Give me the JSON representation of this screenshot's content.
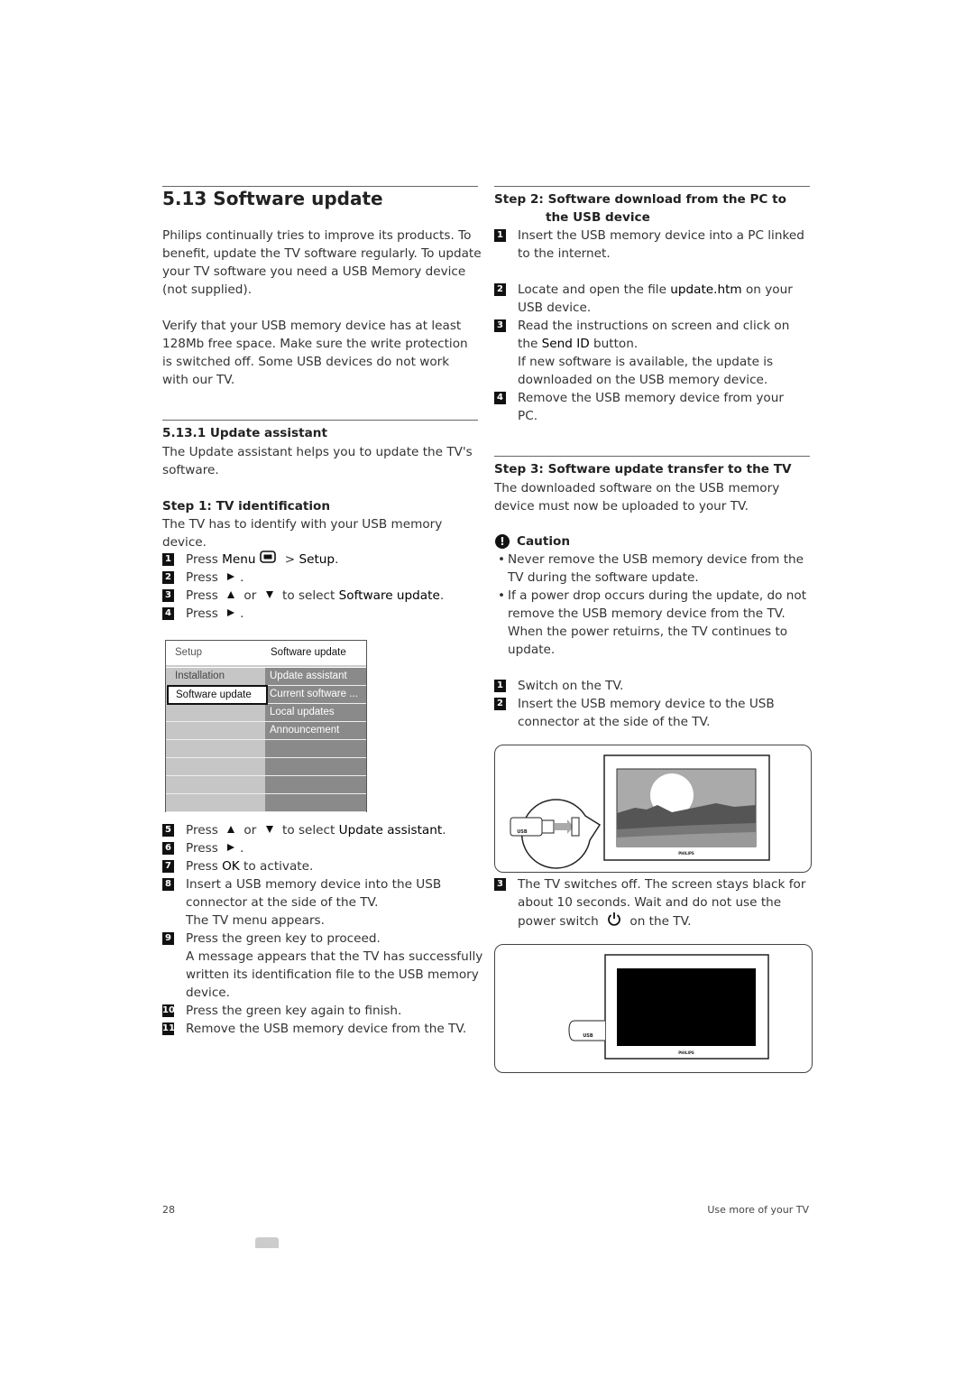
{
  "left": {
    "title": "5.13  Software update",
    "intro": [
      [
        "Philips continually tries to improve its products. To"
      ],
      [
        "benefit, update the TV software regularly. To update"
      ],
      [
        "your TV software you need a USB Memory device"
      ],
      [
        "(not supplied)."
      ]
    ],
    "verify": [
      [
        "Verify that your USB memory device has at least"
      ],
      [
        "128Mb free space. Make sure the write protection"
      ],
      [
        "is switched off. Some USB devices do not work"
      ],
      [
        "with our TV."
      ]
    ],
    "sub_heading": "5.13.1   Update assistant",
    "sub_text": [
      [
        "The Update assistant helps you to update the TV's"
      ],
      [
        "software."
      ]
    ],
    "step1_heading": "Step 1: TV identification",
    "step1_intro": [
      [
        "The TV has to identify with your USB memory"
      ],
      [
        "device."
      ]
    ],
    "steps_a": [
      {
        "n": "1",
        "lines": [
          [
            "Press ",
            {
              "b": "Menu"
            },
            {
              "icon": "menu"
            },
            " > ",
            {
              "b": "Setup"
            },
            "."
          ]
        ]
      },
      {
        "n": "2",
        "lines": [
          [
            "Press ",
            {
              "icon": "right"
            },
            "."
          ]
        ]
      },
      {
        "n": "3",
        "lines": [
          [
            "Press ",
            {
              "icon": "up"
            },
            " or ",
            {
              "icon": "down"
            },
            " to select ",
            {
              "b": "Software update"
            },
            "."
          ]
        ]
      },
      {
        "n": "4",
        "lines": [
          [
            "Press ",
            {
              "icon": "right"
            },
            "."
          ]
        ]
      }
    ],
    "menu": {
      "header_left": "Setup",
      "header_right": "Software update",
      "left_items": [
        "Installation",
        "Software update"
      ],
      "selected": "Software update",
      "right_items": [
        "Update assistant",
        "Current software ...",
        "Local updates",
        "Announcement"
      ],
      "empty_rows": 8
    },
    "steps_b": [
      {
        "n": "5",
        "lines": [
          [
            "Press ",
            {
              "icon": "up"
            },
            " or ",
            {
              "icon": "down"
            },
            " to select ",
            {
              "b": "Update assistant"
            },
            "."
          ]
        ]
      },
      {
        "n": "6",
        "lines": [
          [
            "Press ",
            {
              "icon": "right"
            },
            "."
          ]
        ]
      },
      {
        "n": "7",
        "lines": [
          [
            "Press ",
            {
              "b": "OK"
            },
            " to activate."
          ]
        ]
      },
      {
        "n": "8",
        "lines": [
          [
            "Insert a USB memory device into the USB"
          ],
          [
            "connector at the side of the TV."
          ],
          [
            "The TV menu appears."
          ]
        ]
      },
      {
        "n": "9",
        "lines": [
          [
            "Press the green key to proceed."
          ],
          [
            "A message appears that the TV has successfully"
          ],
          [
            "written its identification file to the USB memory"
          ],
          [
            "device."
          ]
        ]
      },
      {
        "n": "10",
        "lines": [
          [
            "Press the green key again to finish."
          ]
        ]
      },
      {
        "n": "11",
        "lines": [
          [
            "Remove the USB memory device from the TV."
          ]
        ]
      }
    ]
  },
  "right": {
    "step2_heading": [
      "Step 2: Software download from the PC to",
      "the USB device"
    ],
    "step2_items": [
      {
        "n": "1",
        "lines": [
          [
            "Insert the USB memory device into a PC linked"
          ],
          [
            "to the internet."
          ],
          [
            ""
          ]
        ]
      },
      {
        "n": "2",
        "lines": [
          [
            "Locate and open the file ",
            {
              "b": "update.htm"
            },
            " on your"
          ],
          [
            "USB device."
          ]
        ]
      },
      {
        "n": "3",
        "lines": [
          [
            "Read the instructions on screen and click on"
          ],
          [
            "the ",
            {
              "b": "Send ID"
            },
            " button."
          ],
          [
            "If new software is available, the update is"
          ],
          [
            "downloaded on the USB memory device."
          ]
        ]
      },
      {
        "n": "4",
        "lines": [
          [
            "Remove the USB memory device from your"
          ],
          [
            "PC."
          ]
        ]
      }
    ],
    "step3_heading": "Step 3: Software update transfer to the TV",
    "step3_intro": [
      [
        "The downloaded software on the USB memory"
      ],
      [
        "device must now be uploaded to your TV."
      ]
    ],
    "caution_label": "Caution",
    "caution_bullets": [
      [
        [
          "Never remove the USB memory device from the"
        ],
        [
          "TV during the software update."
        ]
      ],
      [
        [
          "If a power drop occurs during the update, do not"
        ],
        [
          "remove the USB memory device from the TV."
        ],
        [
          "When the power retuirns, the TV continues to"
        ],
        [
          "update."
        ]
      ]
    ],
    "step3_items": [
      {
        "n": "1",
        "lines": [
          [
            "Switch on the TV."
          ]
        ]
      },
      {
        "n": "2",
        "lines": [
          [
            "Insert the USB memory device to the USB"
          ],
          [
            "connector at the side of the TV."
          ]
        ]
      }
    ],
    "step3_items_b": [
      {
        "n": "3",
        "lines": [
          [
            "The TV switches off. The screen stays black for"
          ],
          [
            "about 10 seconds. Wait and do not use the"
          ],
          [
            "power switch ",
            {
              "icon": "power"
            },
            " on the TV."
          ]
        ]
      }
    ],
    "illustration": {
      "usb_label": "USB",
      "brand": "PHILIPS"
    }
  },
  "footer": {
    "page_number": "28",
    "section": "Use more of your TV"
  },
  "colors": {
    "menu_left": "#c6c6c6",
    "menu_right": "#8a8a8a",
    "text": "#333333"
  }
}
